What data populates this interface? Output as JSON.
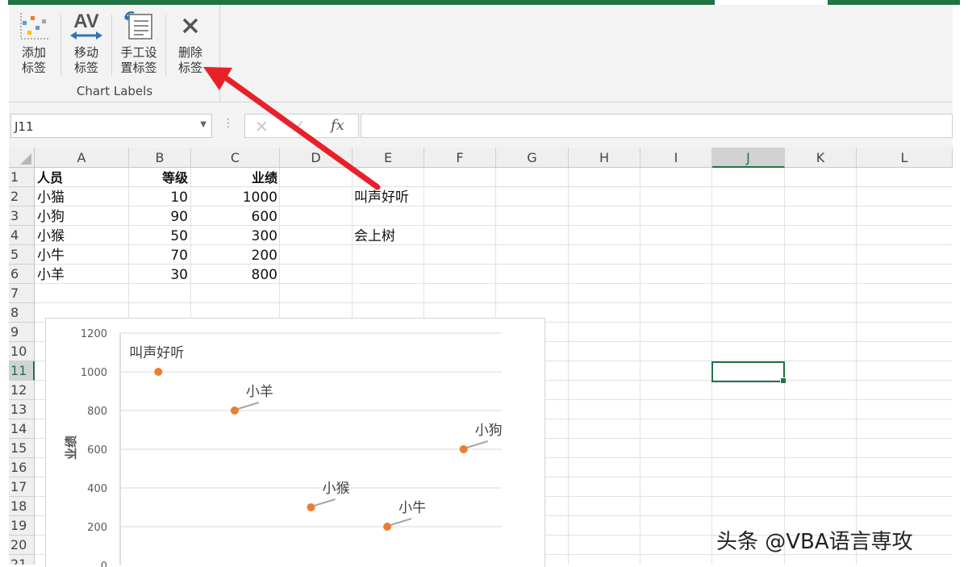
{
  "ribbon": {
    "buttons": [
      {
        "line1": "添加",
        "line2": "标签",
        "icon": "add-labels-icon"
      },
      {
        "line1": "移动",
        "line2": "标签",
        "icon": "move-labels-icon"
      },
      {
        "line1": "手工设",
        "line2": "置标签",
        "icon": "manual-labels-icon"
      },
      {
        "line1": "删除",
        "line2": "标签",
        "icon": "delete-labels-icon"
      }
    ],
    "group_title": "Chart Labels"
  },
  "formula_bar": {
    "name_box": "J11",
    "fx_label": "fx",
    "formula": ""
  },
  "sheet": {
    "columns": [
      "A",
      "B",
      "C",
      "D",
      "E",
      "F",
      "G",
      "H",
      "I",
      "J",
      "K",
      "L"
    ],
    "selected_column": "J",
    "rows": [
      "1",
      "2",
      "3",
      "4",
      "5",
      "6",
      "7",
      "8",
      "9",
      "10",
      "11",
      "12",
      "13",
      "14",
      "15",
      "16",
      "17",
      "18",
      "19",
      "20",
      "21"
    ],
    "selected_row": "11",
    "headers": {
      "a": "人员",
      "b": "等级",
      "c": "业绩"
    },
    "data": [
      {
        "name": "小猫",
        "level": "10",
        "perf": "1000"
      },
      {
        "name": "小狗",
        "level": "90",
        "perf": "600"
      },
      {
        "name": "小猴",
        "level": "50",
        "perf": "300"
      },
      {
        "name": "小牛",
        "level": "70",
        "perf": "200"
      },
      {
        "name": "小羊",
        "level": "30",
        "perf": "800"
      }
    ],
    "e_column": {
      "e2": "叫声好听",
      "e4": "会上树"
    }
  },
  "chart_data": {
    "type": "scatter",
    "ylabel": "业绩",
    "ylim": [
      0,
      1200
    ],
    "yticks": [
      "0",
      "200",
      "400",
      "600",
      "800",
      "1000",
      "1200"
    ],
    "points": [
      {
        "x": 10,
        "y": 1000,
        "label": "叫声好听"
      },
      {
        "x": 30,
        "y": 800,
        "label": "小羊"
      },
      {
        "x": 50,
        "y": 300,
        "label": "小猴"
      },
      {
        "x": 70,
        "y": 200,
        "label": "小牛"
      },
      {
        "x": 90,
        "y": 600,
        "label": "小狗"
      }
    ],
    "marker_color": "#ed7d31",
    "grid": true
  },
  "watermark": "头条 @VBA语言専攻",
  "colors": {
    "excel_green": "#217346",
    "arrow": "#e8202a"
  }
}
